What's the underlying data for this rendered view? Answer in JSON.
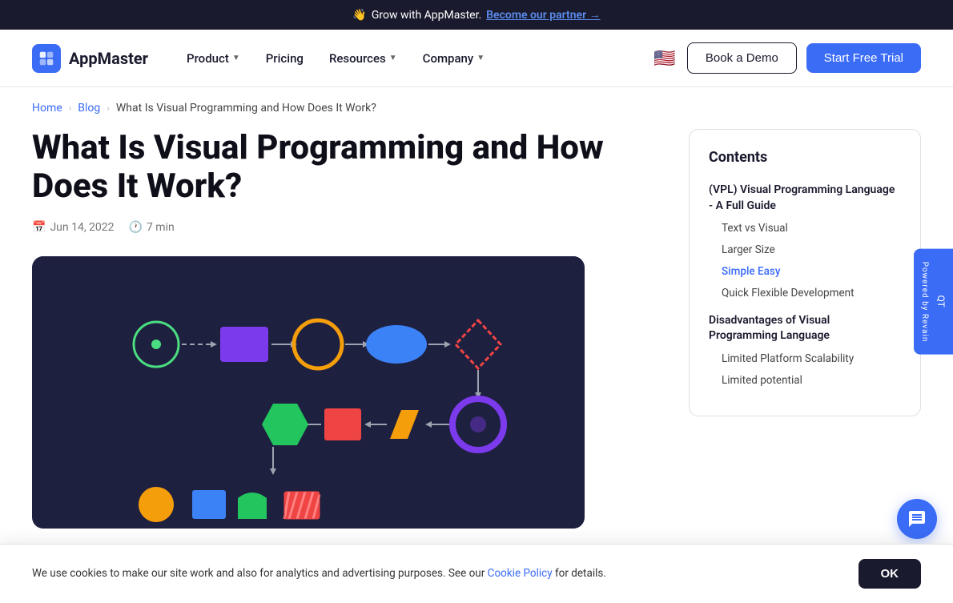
{
  "banner": {
    "emoji": "👋",
    "text": "Grow with AppMaster.",
    "link_text": "Become our partner →"
  },
  "header": {
    "logo_text": "AppMaster",
    "nav_items": [
      {
        "label": "Product",
        "has_dropdown": true
      },
      {
        "label": "Pricing",
        "has_dropdown": false
      },
      {
        "label": "Resources",
        "has_dropdown": true
      },
      {
        "label": "Company",
        "has_dropdown": true
      }
    ],
    "book_demo_label": "Book a Demo",
    "start_trial_label": "Start Free Trial",
    "flag_emoji": "🇺🇸"
  },
  "breadcrumb": {
    "home": "Home",
    "blog": "Blog",
    "current": "What Is Visual Programming and How Does It Work?"
  },
  "article": {
    "title": "What Is Visual Programming and How Does It Work?",
    "date": "Jun 14, 2022",
    "read_time": "7 min"
  },
  "sidebar": {
    "title": "Contents",
    "sections": [
      {
        "label": "(VPL) Visual Programming Language - A Full Guide",
        "sub_items": [
          {
            "label": "Text vs Visual",
            "active": false
          },
          {
            "label": "Larger Size",
            "active": false
          },
          {
            "label": "Simple Easy",
            "active": true
          },
          {
            "label": "Quick Flexible Development",
            "active": false
          }
        ]
      },
      {
        "label": "Disadvantages of Visual Programming Language",
        "sub_items": [
          {
            "label": "Limited Platform Scalability",
            "active": false
          },
          {
            "label": "Limited potential",
            "active": false
          }
        ]
      }
    ]
  },
  "cookie": {
    "text": "We use cookies to make our site work and also for analytics and advertising purposes. See our Cookie Policy for details.",
    "ok_label": "OK",
    "link_text": "Cookie Policy"
  },
  "revain": {
    "label": "Powered by Revain",
    "rating": "QT"
  }
}
